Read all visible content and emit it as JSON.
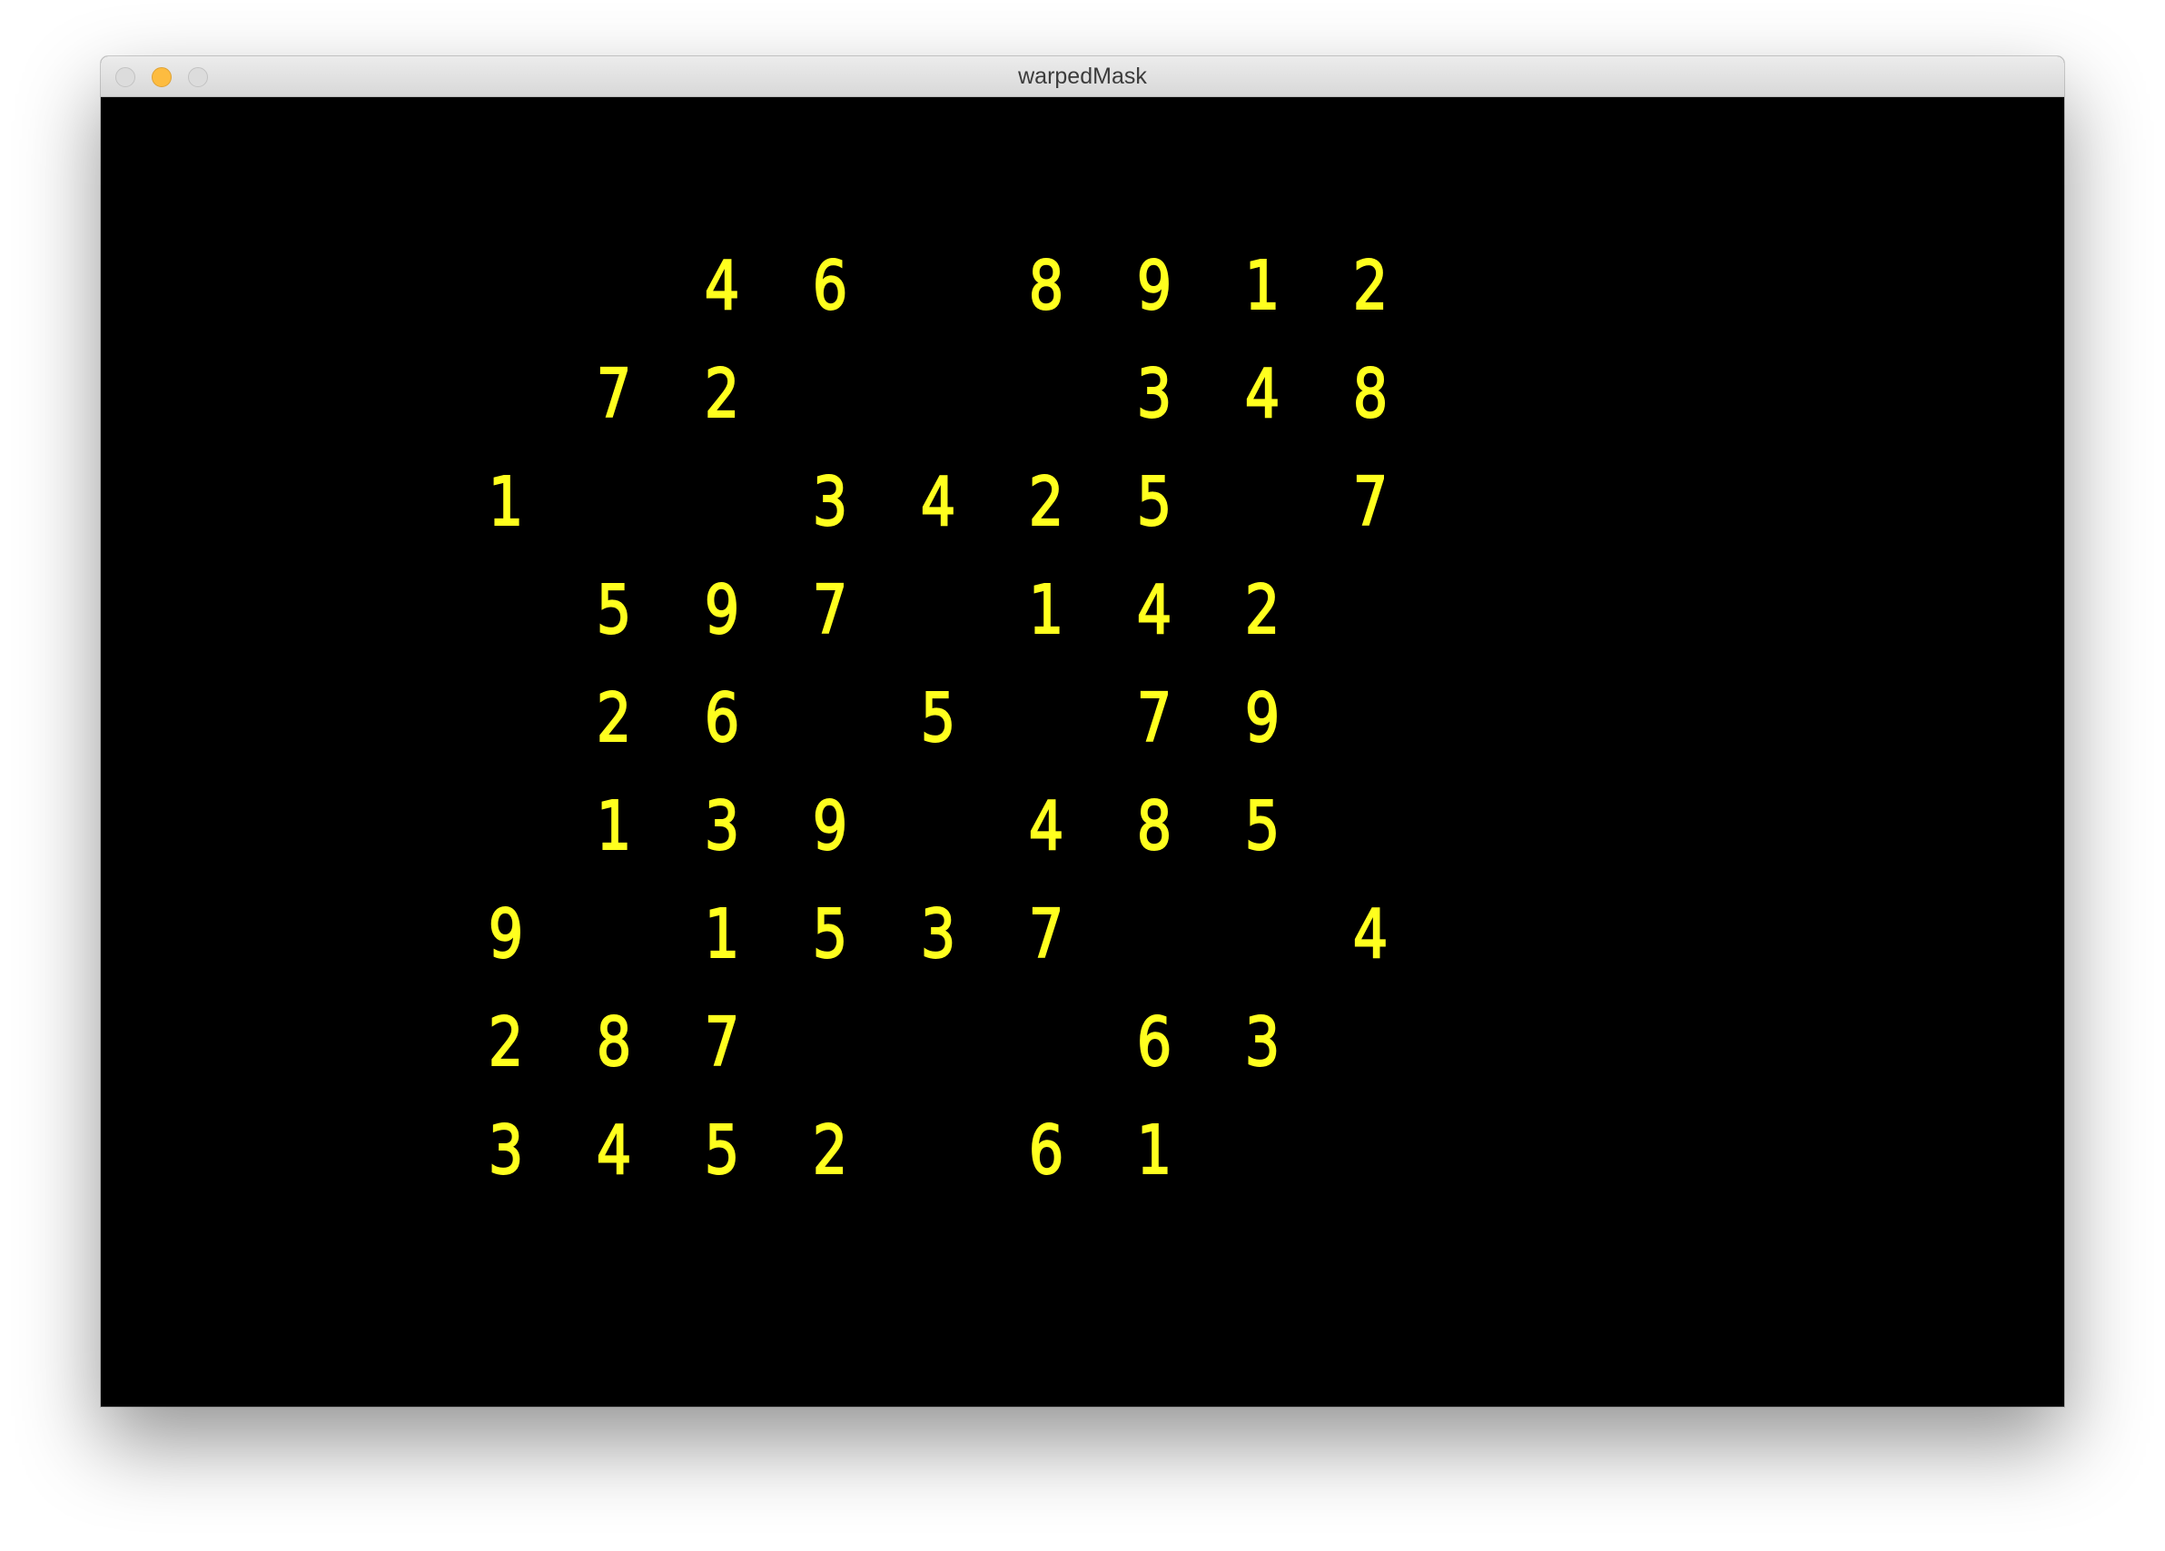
{
  "window": {
    "title": "warpedMask"
  },
  "digit_color": "#ffff1e",
  "grid": [
    [
      "",
      "",
      "4",
      "6",
      "",
      "8",
      "9",
      "1",
      "2"
    ],
    [
      "",
      "7",
      "2",
      "",
      "",
      "",
      "3",
      "4",
      "8"
    ],
    [
      "1",
      "",
      "",
      "3",
      "4",
      "2",
      "5",
      "",
      "7"
    ],
    [
      "",
      "5",
      "9",
      "7",
      "",
      "1",
      "4",
      "2",
      ""
    ],
    [
      "",
      "2",
      "6",
      "",
      "5",
      "",
      "7",
      "9",
      ""
    ],
    [
      "",
      "1",
      "3",
      "9",
      "",
      "4",
      "8",
      "5",
      ""
    ],
    [
      "9",
      "",
      "1",
      "5",
      "3",
      "7",
      "",
      "",
      "4"
    ],
    [
      "2",
      "8",
      "7",
      "",
      "",
      "",
      "6",
      "3",
      ""
    ],
    [
      "3",
      "4",
      "5",
      "2",
      "",
      "6",
      "1",
      "",
      ""
    ]
  ]
}
